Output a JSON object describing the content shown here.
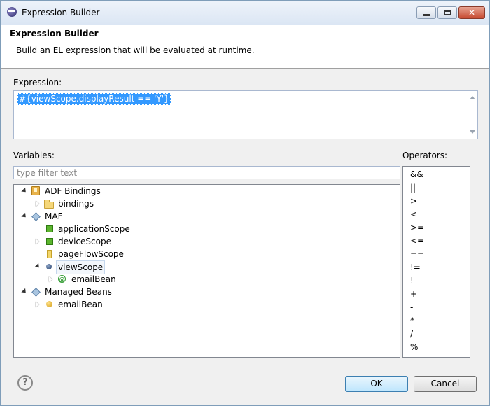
{
  "window": {
    "title": "Expression Builder"
  },
  "header": {
    "title": "Expression Builder",
    "description": "Build an EL expression that will be evaluated at runtime."
  },
  "expression": {
    "label": "Expression:",
    "value": "#{viewScope.displayResult == 'Y'}"
  },
  "variables": {
    "label": "Variables:",
    "filter_placeholder": "type filter text",
    "tree": [
      {
        "label": "ADF Bindings",
        "icon": "adf-bindings-icon",
        "state": "expanded"
      },
      {
        "label": "bindings",
        "icon": "folder-icon",
        "state": "collapsed"
      },
      {
        "label": "MAF",
        "icon": "diamond-icon",
        "state": "expanded"
      },
      {
        "label": "applicationScope",
        "icon": "scope-icon",
        "state": "leaf"
      },
      {
        "label": "deviceScope",
        "icon": "scope-icon",
        "state": "collapsed"
      },
      {
        "label": "pageFlowScope",
        "icon": "scope-icon",
        "state": "leaf"
      },
      {
        "label": "viewScope",
        "icon": "scope-icon",
        "state": "expanded"
      },
      {
        "label": "emailBean",
        "icon": "at-icon",
        "state": "collapsed"
      },
      {
        "label": "Managed Beans",
        "icon": "diamond-icon",
        "state": "expanded"
      },
      {
        "label": "emailBean",
        "icon": "bean-icon",
        "state": "collapsed"
      }
    ]
  },
  "operators": {
    "label": "Operators:",
    "items": [
      "&&",
      "||",
      ">",
      "<",
      ">=",
      "<=",
      "==",
      "!=",
      "!",
      "+",
      "-",
      "*",
      "/",
      "%"
    ]
  },
  "buttons": {
    "help": "?",
    "ok": "OK",
    "cancel": "Cancel"
  }
}
